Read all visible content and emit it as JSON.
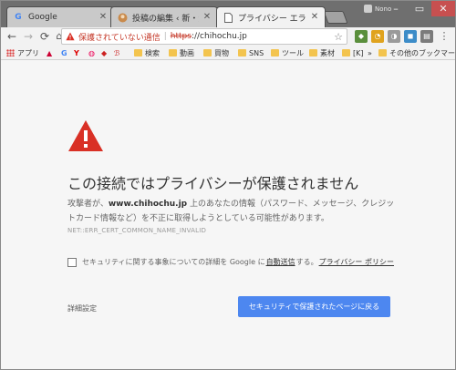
{
  "tabs": [
    {
      "label": "Google",
      "icon": "google-icon",
      "active": false
    },
    {
      "label": "投稿の編集 ‹ 新・元祖気",
      "icon": "wordpress-icon",
      "active": false
    },
    {
      "label": "プライバシー エラー",
      "icon": "page-icon",
      "active": true
    }
  ],
  "window": {
    "user_name": "Nono"
  },
  "omnibox": {
    "security_label": "保護されていない通信",
    "separator": "|",
    "scheme": "https",
    "host": "://chihochu.jp"
  },
  "bookmarks": {
    "apps_label": "アプリ",
    "items": [
      "検索",
      "動画",
      "買物",
      "SNS",
      "ツール",
      "素材",
      "[K]"
    ],
    "overflow": "»",
    "other_label": "その他のブックマーク"
  },
  "interstitial": {
    "headline": "この接続ではプライバシーが保護されません",
    "body_prefix": "攻撃者が、",
    "body_host": "www.chihochu.jp",
    "body_suffix": " 上のあなたの情報（パスワード、メッセージ、クレジットカード情報など）を不正に取得しようとしている可能性があります。",
    "error_code": "NET::ERR_CERT_COMMON_NAME_INVALID",
    "checkbox_prefix": "セキュリティに関する事象についての詳細を Google に",
    "checkbox_link1": "自動送信",
    "checkbox_mid": "する。",
    "checkbox_link2": "プライバシー ポリシー",
    "details_label": "詳細設定",
    "back_button_label": "セキュリティで保護されたページに戻る"
  },
  "colors": {
    "warning_red": "#d93025",
    "primary_blue": "#4d87f0"
  }
}
